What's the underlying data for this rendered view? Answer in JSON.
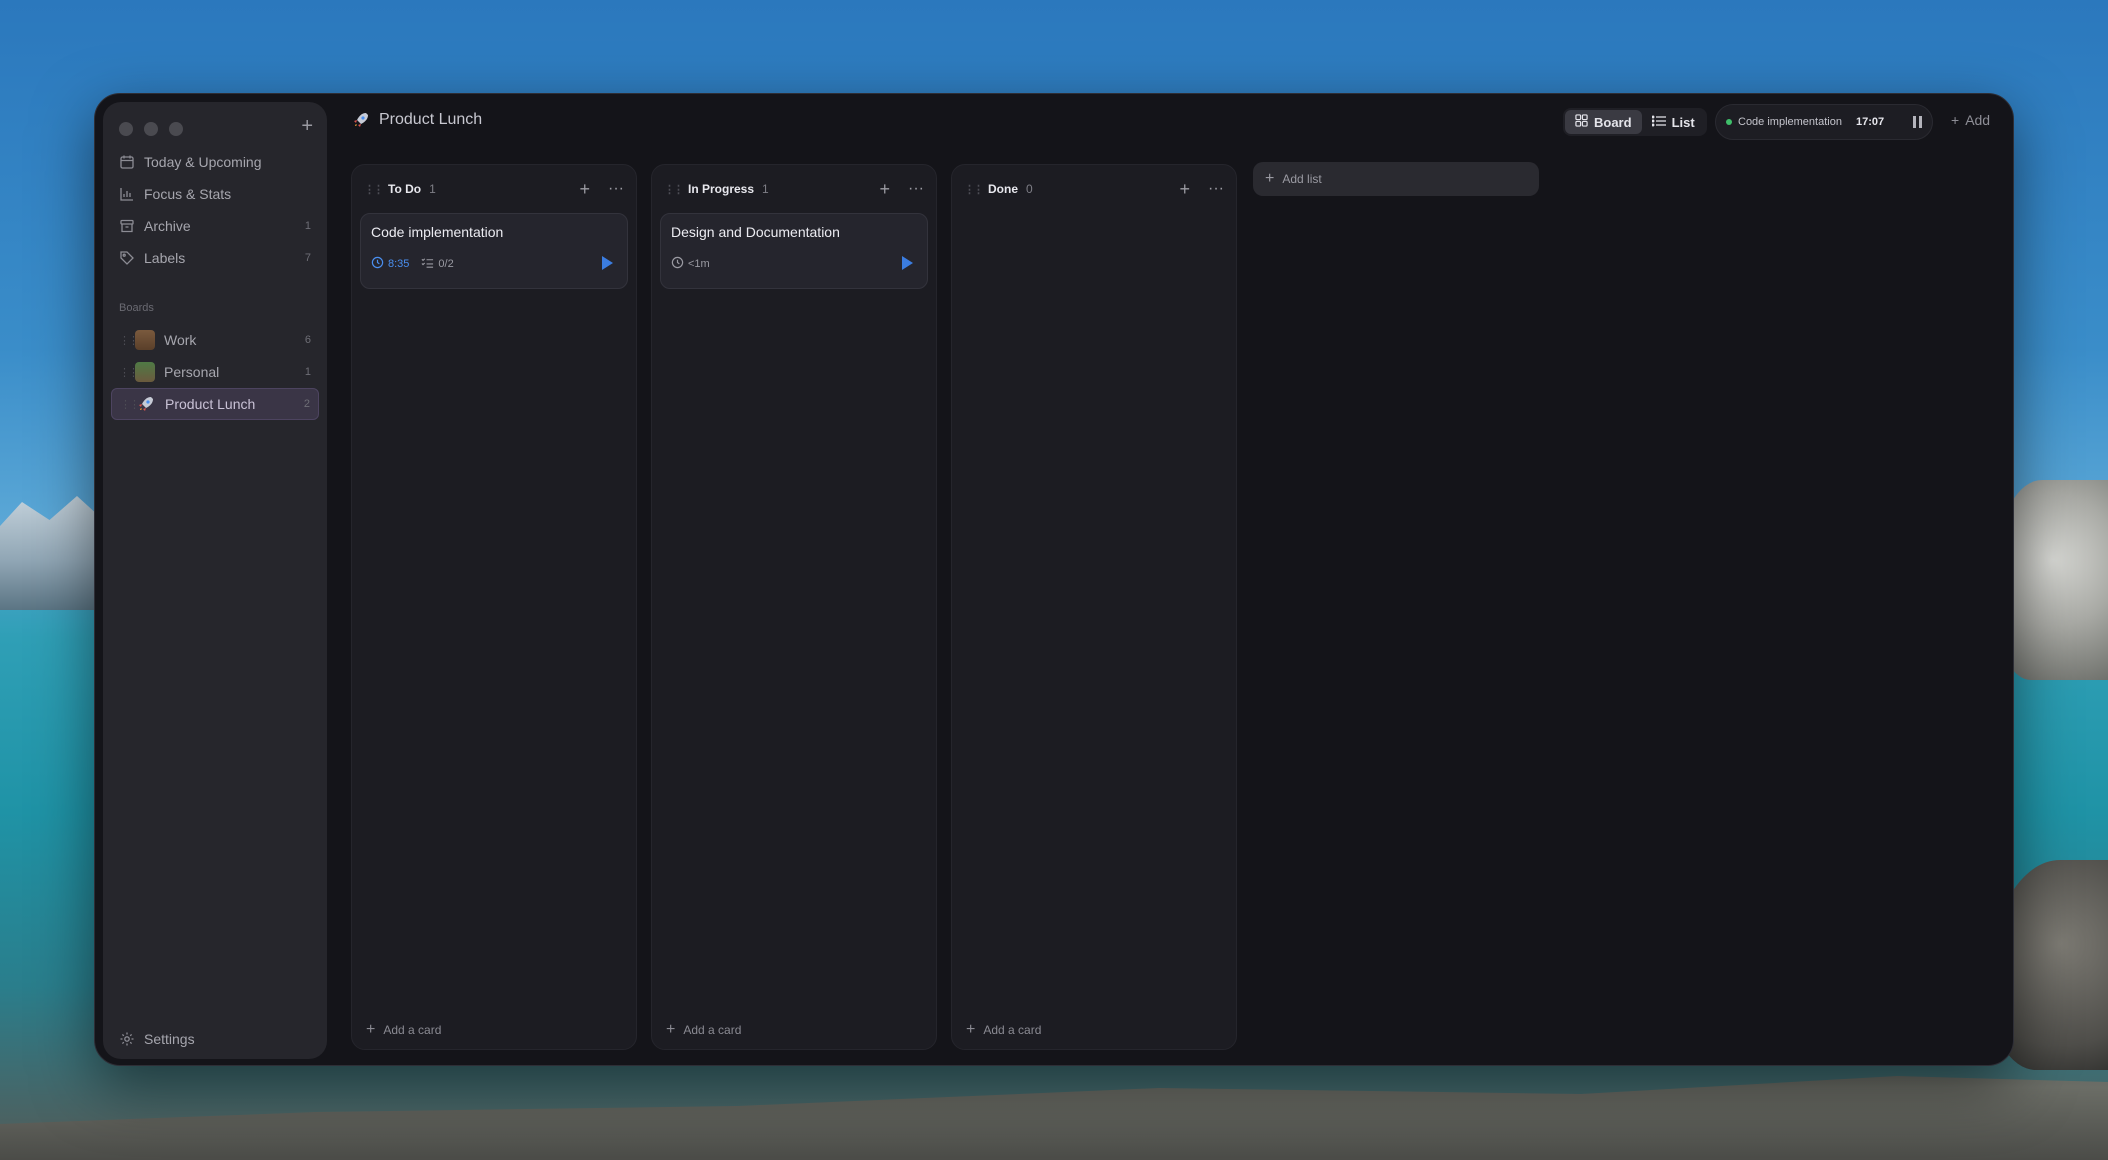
{
  "app": {
    "board_title": "Product Lunch",
    "board_emoji": "rocket"
  },
  "sidebar": {
    "nav": [
      {
        "label": "Today & Upcoming",
        "icon": "calendar-icon",
        "count": ""
      },
      {
        "label": "Focus & Stats",
        "icon": "chart-icon",
        "count": ""
      },
      {
        "label": "Archive",
        "icon": "archive-icon",
        "count": "1"
      },
      {
        "label": "Labels",
        "icon": "tag-icon",
        "count": "7"
      }
    ],
    "boards_label": "Boards",
    "boards": [
      {
        "label": "Work",
        "count": "6",
        "emoji": "briefcase"
      },
      {
        "label": "Personal",
        "count": "1",
        "emoji": "house"
      },
      {
        "label": "Product Lunch",
        "count": "2",
        "emoji": "rocket",
        "active": true
      }
    ],
    "settings_label": "Settings"
  },
  "toolbar": {
    "board_label": "Board",
    "list_label": "List",
    "timer_task": "Code implementation",
    "timer_time": "17:07",
    "add_label": "Add"
  },
  "columns": [
    {
      "title": "To Do",
      "count": "1",
      "cards": [
        {
          "title": "Code implementation",
          "time": "8:35",
          "checklist": "0/2"
        }
      ],
      "add_card_label": "Add a card"
    },
    {
      "title": "In Progress",
      "count": "1",
      "cards": [
        {
          "title": "Design and Documentation",
          "time": "<1m"
        }
      ],
      "add_card_label": "Add a card"
    },
    {
      "title": "Done",
      "count": "0",
      "cards": [],
      "add_card_label": "Add a card"
    }
  ],
  "add_list_label": "Add list",
  "colors": {
    "accent_blue": "#3b7de0",
    "timer_dot": "#3fbf6a",
    "active_board_bg": "#3a3546"
  }
}
